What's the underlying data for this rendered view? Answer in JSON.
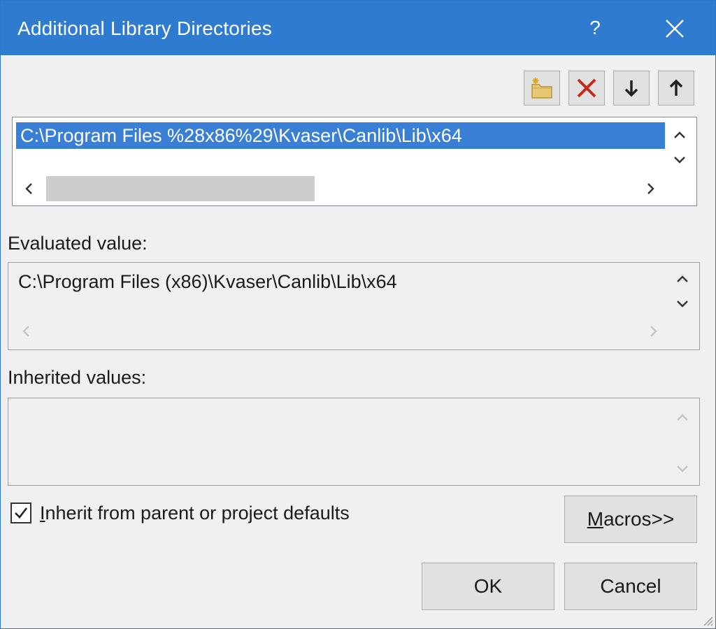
{
  "window": {
    "title": "Additional Library Directories",
    "help_label": "?",
    "accent_color": "#2f7bd0",
    "selection_color": "#3a7fd6"
  },
  "toolbar": {
    "buttons": [
      {
        "icon": "new-folder-icon"
      },
      {
        "icon": "delete-x-icon"
      },
      {
        "icon": "move-down-arrow-icon"
      },
      {
        "icon": "move-up-arrow-icon"
      }
    ]
  },
  "directories": {
    "items": [
      "C:\\Program Files %28x86%29\\Kvaser\\Canlib\\Lib\\x64"
    ]
  },
  "evaluated": {
    "label": "Evaluated value:",
    "value": "C:\\Program Files (x86)\\Kvaser\\Canlib\\Lib\\x64"
  },
  "inherited": {
    "label": "Inherited values:"
  },
  "inherit_checkbox": {
    "checked": true,
    "label_prefix": "",
    "label_mnemonic": "I",
    "label_rest": "nherit from parent or project defaults"
  },
  "buttons": {
    "macros_mnemonic": "M",
    "macros_rest": "acros>>",
    "ok": "OK",
    "cancel": "Cancel"
  }
}
